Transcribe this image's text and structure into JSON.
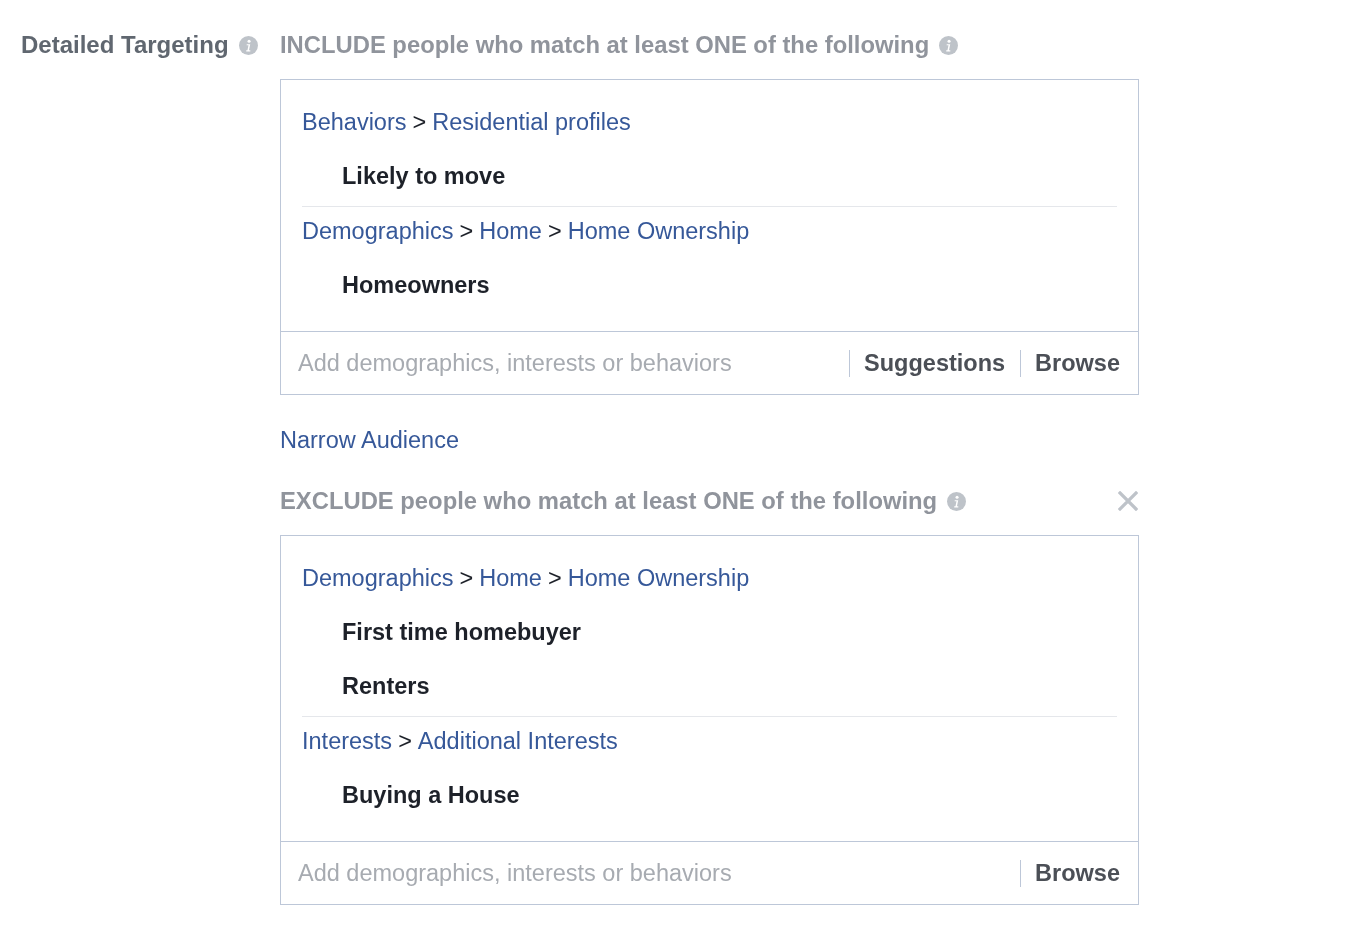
{
  "label": "Detailed Targeting",
  "sections": [
    {
      "heading": "INCLUDE people who match at least ONE of the following",
      "closable": false,
      "groups": [
        {
          "path": [
            {
              "kind": "link",
              "text": "Behaviors"
            },
            {
              "kind": "separator",
              "text": ">"
            },
            {
              "kind": "link",
              "text": "Residential profiles"
            }
          ],
          "items": [
            "Likely to move"
          ]
        },
        {
          "path": [
            {
              "kind": "link",
              "text": "Demographics"
            },
            {
              "kind": "separator",
              "text": ">"
            },
            {
              "kind": "link",
              "text": "Home"
            },
            {
              "kind": "separator",
              "text": ">"
            },
            {
              "kind": "link",
              "text": "Home Ownership"
            }
          ],
          "items": [
            "Homeowners"
          ]
        }
      ],
      "input": {
        "placeholder": "Add demographics, interests or behaviors"
      },
      "actions": [
        "Suggestions",
        "Browse"
      ]
    },
    {
      "kind": "link",
      "text": "Narrow Audience"
    },
    {
      "heading": "EXCLUDE people who match at least ONE of the following",
      "closable": true,
      "groups": [
        {
          "path": [
            {
              "kind": "link",
              "text": "Demographics"
            },
            {
              "kind": "separator",
              "text": ">"
            },
            {
              "kind": "link",
              "text": "Home"
            },
            {
              "kind": "separator",
              "text": ">"
            },
            {
              "kind": "link",
              "text": "Home Ownership"
            }
          ],
          "items": [
            "First time homebuyer",
            "Renters"
          ]
        },
        {
          "path": [
            {
              "kind": "link",
              "text": "Interests"
            },
            {
              "kind": "separator",
              "text": ">"
            },
            {
              "kind": "link",
              "text": "Additional Interests"
            }
          ],
          "items": [
            "Buying a House"
          ]
        }
      ],
      "input": {
        "placeholder": "Add demographics, interests or behaviors"
      },
      "actions": [
        "Browse"
      ]
    }
  ]
}
